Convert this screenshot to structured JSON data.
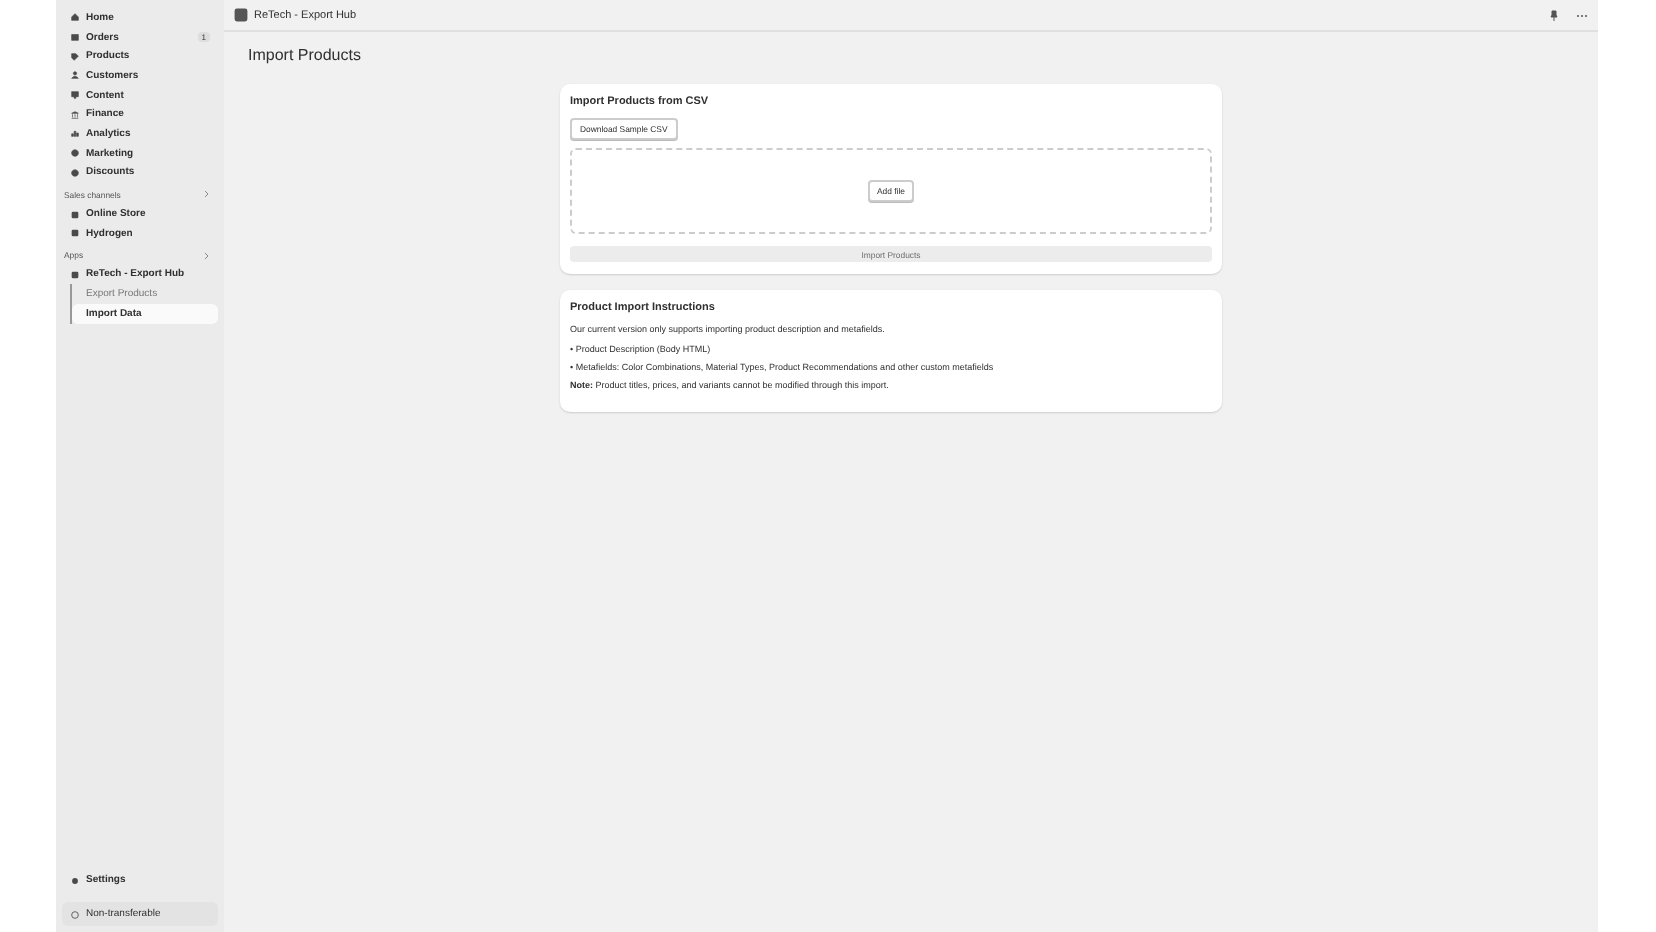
{
  "sidebar": {
    "items": [
      {
        "label": "Home",
        "selected": false
      },
      {
        "label": "Orders",
        "badge": "1",
        "selected": false
      },
      {
        "label": "Products",
        "selected": false
      },
      {
        "label": "Customers",
        "selected": false
      },
      {
        "label": "Content",
        "selected": false
      },
      {
        "label": "Finance",
        "selected": false
      },
      {
        "label": "Analytics",
        "selected": false
      },
      {
        "label": "Marketing",
        "selected": false
      },
      {
        "label": "Discounts",
        "selected": false
      }
    ],
    "sections": [
      {
        "title": "Sales channels",
        "items": [
          {
            "label": "Online Store",
            "selected": false
          },
          {
            "label": "Hydrogen",
            "selected": false
          }
        ]
      },
      {
        "title": "Apps",
        "items": [
          {
            "label": "ReTech - Export Hub",
            "selected": false,
            "children": [
              {
                "label": "Export Products",
                "selected": false
              },
              {
                "label": "Import Data",
                "selected": true
              }
            ]
          }
        ]
      }
    ],
    "settings": "Settings",
    "footer": "Non-transferable"
  },
  "header": {
    "app_title": "ReTech - Export Hub"
  },
  "page_title": "Import Products",
  "import_card": {
    "title": "Import Products from CSV",
    "download_button": "Download Sample CSV",
    "add_file_button": "Add file",
    "import_button": {
      "label": "Import Products",
      "disabled": true
    }
  },
  "instructions": {
    "title": "Product Import Instructions",
    "intro": "Our current version only supports importing product description and metafields.",
    "bullets": [
      "• Product Description (Body HTML)",
      "• Metafields: Color Combinations, Material Types, Product Recommendations and other custom metafields"
    ],
    "note": "**Note:** Product titles, prices, and variants cannot be modified through this import."
  }
}
